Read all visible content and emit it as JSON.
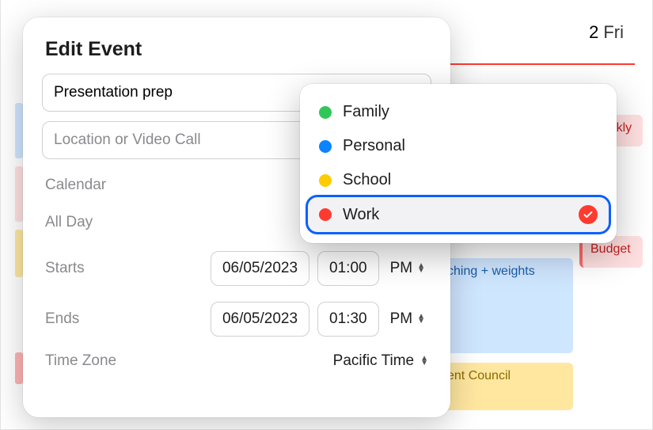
{
  "header": {
    "day_num": "2",
    "day_name": "Fri"
  },
  "bg_events": {
    "weekly": "Weekly",
    "budget": "Budget",
    "stretch": "ching + weights",
    "council": "ent Council"
  },
  "popover": {
    "title": "Edit Event",
    "event_name": "Presentation prep",
    "location_placeholder": "Location or Video Call",
    "labels": {
      "calendar": "Calendar",
      "allday": "All Day",
      "starts": "Starts",
      "ends": "Ends",
      "tz": "Time Zone"
    },
    "starts": {
      "date": "06/05/2023",
      "time": "01:00",
      "ampm": "PM"
    },
    "ends": {
      "date": "06/05/2023",
      "time": "01:30",
      "ampm": "PM"
    },
    "timezone": "Pacific Time",
    "allday_on": false
  },
  "calendar_menu": {
    "options": [
      {
        "label": "Family",
        "color": "#30c759"
      },
      {
        "label": "Personal",
        "color": "#0a84ff"
      },
      {
        "label": "School",
        "color": "#ffcc00"
      },
      {
        "label": "Work",
        "color": "#ff3b30"
      }
    ],
    "selected_index": 3
  }
}
